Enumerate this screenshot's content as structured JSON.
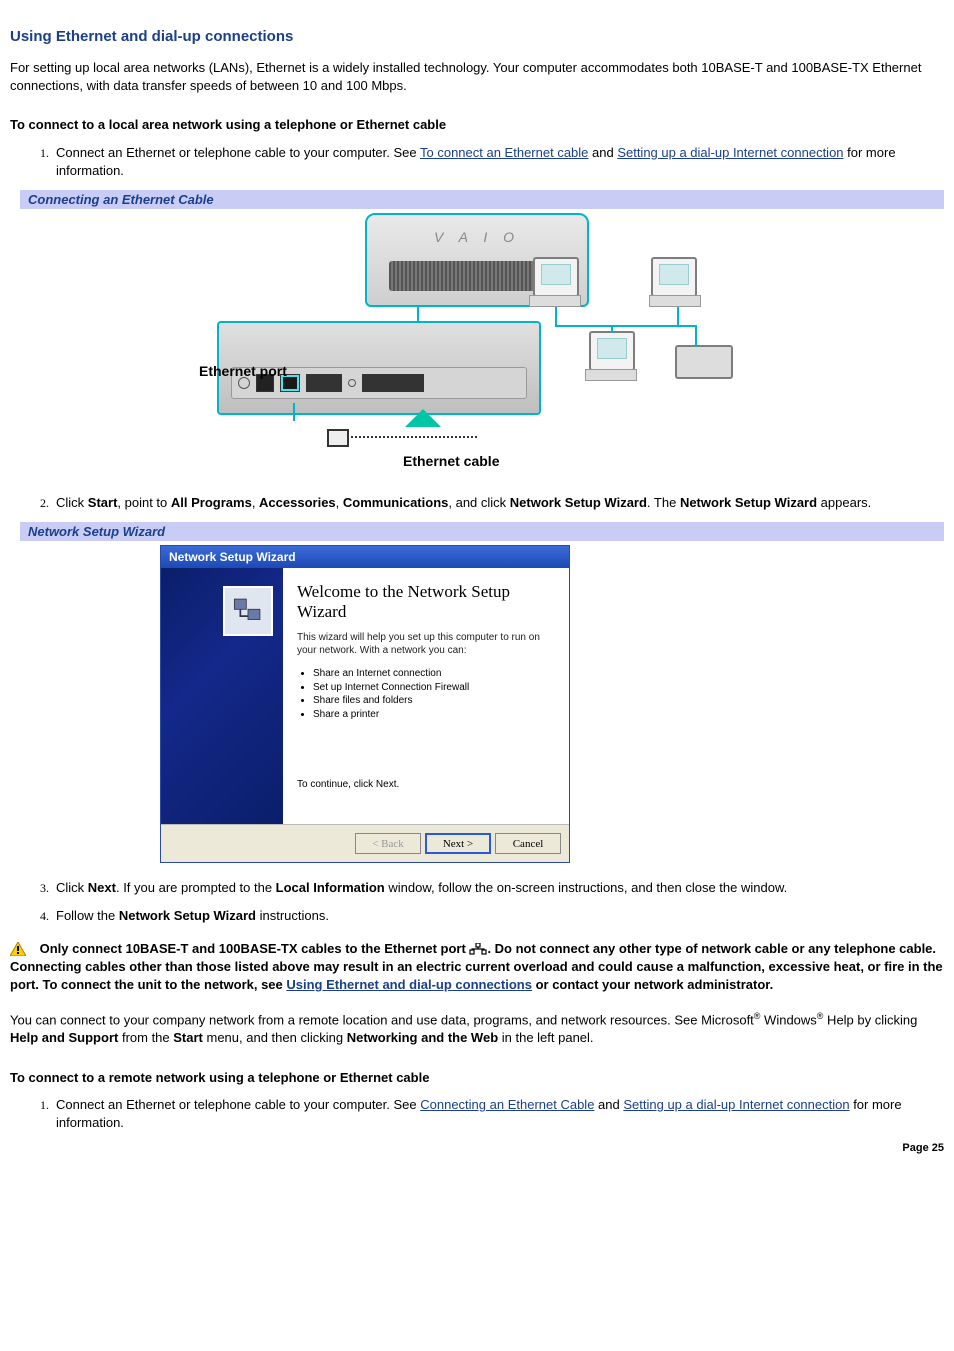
{
  "title": "Using Ethernet and dial-up connections",
  "intro": "For setting up local area networks (LANs), Ethernet is a widely installed technology. Your computer accommodates both 10BASE-T and 100BASE-TX Ethernet connections, with data transfer speeds of between 10 and 100 Mbps.",
  "section_lan_heading": "To connect to a local area network using a telephone or Ethernet cable",
  "step1_pre": "Connect an Ethernet or telephone cable to your computer. See ",
  "step1_link1": "To connect an Ethernet cable",
  "step1_mid": " and ",
  "step1_link2": "Setting up a dial-up Internet connection",
  "step1_post": " for more information.",
  "caption_ethernet": "Connecting an Ethernet Cable",
  "fig1_labels": {
    "logo": "V A I O",
    "ethernet_port": "Ethernet port",
    "ethernet_cable": "Ethernet cable"
  },
  "step2_parts": {
    "a": "Click ",
    "b": "Start",
    "c": ", point to ",
    "d": "All Programs",
    "e": ", ",
    "f": "Accessories",
    "g": ", ",
    "h": "Communications",
    "i": ", and click ",
    "j": "Network Setup Wizard",
    "k": ". The ",
    "l": "Network Setup Wizard",
    "m": " appears."
  },
  "caption_wizard": "Network Setup Wizard",
  "wizard": {
    "titlebar": "Network Setup Wizard",
    "heading": "Welcome to the Network Setup Wizard",
    "desc": "This wizard will help you set up this computer to run on your network. With a network you can:",
    "bullets": [
      "Share an Internet connection",
      "Set up Internet Connection Firewall",
      "Share files and folders",
      "Share a printer"
    ],
    "continue": "To continue, click Next.",
    "back": "< Back",
    "next": "Next >",
    "cancel": "Cancel"
  },
  "step3_parts": {
    "a": "Click ",
    "b": "Next",
    "c": ". If you are prompted to the ",
    "d": "Local Information",
    "e": " window, follow the on-screen instructions, and then close the window."
  },
  "step4_parts": {
    "a": "Follow the ",
    "b": "Network Setup Wizard",
    "c": " instructions."
  },
  "warning_pre": "Only connect 10BASE-T and 100BASE-TX cables to the Ethernet port ",
  "warning_post1": ". Do not connect any other type of network cable or any telephone cable. Connecting cables other than those listed above may result in an electric current overload and could cause a malfunction, excessive heat, or fire in the port. To connect the unit to the network, see ",
  "warning_link": "Using Ethernet and dial-up connections",
  "warning_post2": " or contact your network administrator.",
  "remote_para": {
    "a": "You can connect to your company network from a remote location and use data, programs, and network resources. See Microsoft",
    "b": " Windows",
    "c": " Help by clicking ",
    "d": "Help and Support",
    "e": " from the ",
    "f": "Start",
    "g": " menu, and then clicking ",
    "h": "Networking and the Web",
    "i": " in the left panel."
  },
  "section_remote_heading": "To connect to a remote network using a telephone or Ethernet cable",
  "remote_step1_pre": "Connect an Ethernet or telephone cable to your computer. See ",
  "remote_step1_link1": "Connecting an Ethernet Cable",
  "remote_step1_mid": " and ",
  "remote_step1_link2": "Setting up a dial-up Internet connection",
  "remote_step1_post": " for more information.",
  "page_number": "Page 25"
}
